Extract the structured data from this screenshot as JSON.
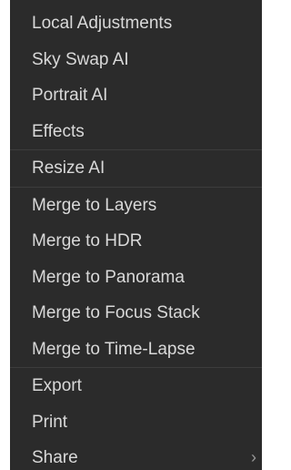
{
  "menu": {
    "groups": [
      {
        "items": [
          "Local Adjustments",
          "Sky Swap AI",
          "Portrait AI",
          "Effects"
        ]
      },
      {
        "items": [
          "Resize AI"
        ]
      },
      {
        "items": [
          "Merge to Layers",
          "Merge to HDR",
          "Merge to Panorama",
          "Merge to Focus Stack",
          "Merge to Time-Lapse"
        ]
      },
      {
        "items": [
          "Export",
          "Print",
          "Share"
        ]
      }
    ],
    "share_submenu_indicator": "chevron-right-icon"
  }
}
